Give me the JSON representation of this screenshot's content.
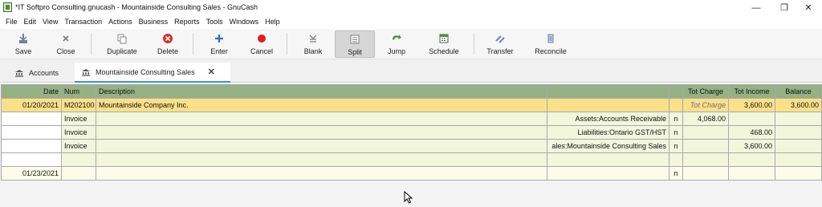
{
  "window": {
    "title": "*IT Softpro Consulting.gnucash - Mountainside Consulting Sales - GnuCash",
    "minimize_glyph": "—",
    "maximize_glyph": "❐",
    "close_glyph": "✕"
  },
  "menu": [
    "File",
    "Edit",
    "View",
    "Transaction",
    "Actions",
    "Business",
    "Reports",
    "Tools",
    "Windows",
    "Help"
  ],
  "toolbar": {
    "save": "Save",
    "close": "Close",
    "duplicate": "Duplicate",
    "delete": "Delete",
    "enter": "Enter",
    "cancel": "Cancel",
    "blank": "Blank",
    "split": "Split",
    "jump": "Jump",
    "schedule": "Schedule",
    "transfer": "Transfer",
    "reconcile": "Reconcile"
  },
  "tabs": [
    {
      "label": "Accounts",
      "icon": "bank-icon"
    },
    {
      "label": "Mountainside Consulting Sales",
      "icon": "bank-icon",
      "active": true
    }
  ],
  "register": {
    "headers": {
      "date": "Date",
      "num": "Num",
      "description": "Description",
      "transfer": "",
      "r": "",
      "charge": "Tot Charge",
      "income": "Tot Income",
      "balance": "Balance"
    },
    "transaction": {
      "date": "01/20/2021",
      "num": "M202100",
      "description": "Mountainside Company Inc.",
      "charge_placeholder": "Tot Charge",
      "income": "3,600.00",
      "balance": "3,600.00"
    },
    "splits": [
      {
        "action": "Invoice",
        "account": "Assets:Accounts Receivable",
        "r": "n",
        "charge": "4,068.00",
        "income": ""
      },
      {
        "action": "Invoice",
        "account": "Liabilities:Ontario GST/HST",
        "r": "n",
        "charge": "",
        "income": "468.00"
      },
      {
        "action": "Invoice",
        "account": "ales:Mountainside Consulting Sales",
        "r": "n",
        "charge": "",
        "income": "3,600.00"
      }
    ],
    "blank_row": {
      "date": "01/23/2021",
      "r": "n"
    }
  },
  "colors": {
    "header": "#96b183",
    "transaction": "#fbe08a",
    "split": "#f2f6dd",
    "tab_accent": "#3b8ee0"
  }
}
